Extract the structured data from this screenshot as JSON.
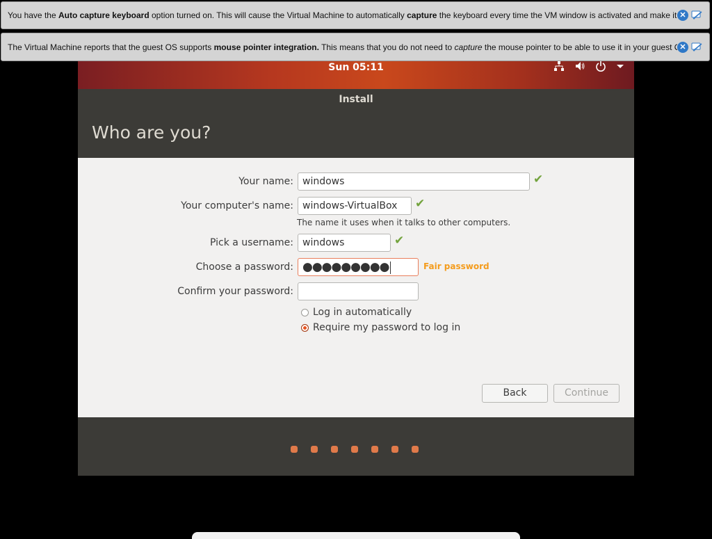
{
  "notifications": [
    {
      "parts": [
        {
          "text": "You have the ",
          "bold": false
        },
        {
          "text": "Auto capture keyboard",
          "bold": true
        },
        {
          "text": " option turned on. This will cause the Virtual Machine to automatically ",
          "bold": false
        },
        {
          "text": "capture",
          "bold": true
        },
        {
          "text": " the keyboard every time the VM window is activated and make it unavailable to",
          "bold": false
        }
      ]
    },
    {
      "parts": [
        {
          "text": "The Virtual Machine reports that the guest OS supports ",
          "bold": false
        },
        {
          "text": "mouse pointer integration.",
          "bold": true
        },
        {
          "text": " This means that you do not need to ",
          "bold": false
        },
        {
          "text": "capture",
          "italic": true
        },
        {
          "text": " the mouse pointer to be able to use it in your guest OS -- all mouse",
          "bold": false
        }
      ]
    }
  ],
  "topbar": {
    "clock": "Sun 05:11",
    "tray_icons": [
      "network-icon",
      "volume-icon",
      "power-icon",
      "dropdown-arrow-icon"
    ]
  },
  "window": {
    "title": "Install",
    "heading": "Who are you?"
  },
  "form": {
    "name_label": "Your name:",
    "name_value": "windows",
    "computer_label": "Your computer's name:",
    "computer_value": "windows-VirtualBox",
    "computer_hint": "The name it uses when it talks to other computers.",
    "username_label": "Pick a username:",
    "username_value": "windows",
    "password_label": "Choose a password:",
    "password_mask": "●●●●●●●●●",
    "password_strength": "Fair password",
    "confirm_label": "Confirm your password:",
    "confirm_value": "",
    "login_auto": "Log in automatically",
    "login_require": "Require my password to log in",
    "selected_login": "require"
  },
  "buttons": {
    "back": "Back",
    "continue": "Continue"
  },
  "progress": {
    "total_steps": 7
  },
  "colors": {
    "ubuntu_orange": "#e95420",
    "check_green": "#73a33d",
    "strength_orange": "#f49c1d"
  }
}
